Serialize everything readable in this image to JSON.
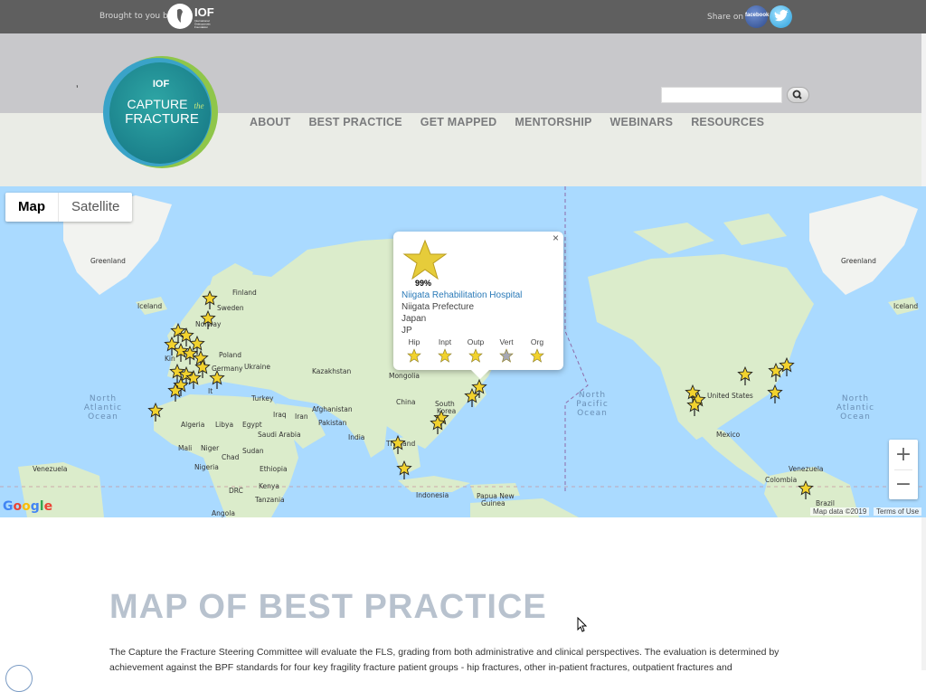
{
  "topbar": {
    "brought_text": "Brought to you by",
    "iof_logo_text": "IOF",
    "iof_logo_sub": "International Osteoporosis Foundation",
    "share_text": "Share on",
    "facebook_label": "facebook"
  },
  "header": {
    "logo_iof": "IOF",
    "logo_capture": "CAPTURE",
    "logo_the": "the",
    "logo_fracture": "FRACTURE",
    "tick_mark": "ʼ",
    "search_placeholder": "",
    "nav": [
      "ABOUT",
      "BEST PRACTICE",
      "GET MAPPED",
      "MENTORSHIP",
      "WEBINARS",
      "RESOURCES"
    ]
  },
  "map": {
    "type_map": "Map",
    "type_satellite": "Satellite",
    "zoom_in": "+",
    "zoom_out": "−",
    "google": "Google",
    "map_data": "Map data ©2019",
    "terms": "Terms of Use",
    "labels": {
      "greenland_left": "Greenland",
      "greenland_right": "Greenland",
      "finland": "Finland",
      "sweden": "Sweden",
      "norway": "Norway",
      "iceland_left": "Iceland",
      "iceland_right": "Iceland",
      "poland": "Poland",
      "germany": "Germany",
      "ukraine": "Ukraine",
      "kazakhstan": "Kazakhstan",
      "mongolia": "Mongolia",
      "china": "China",
      "turkey": "Turkey",
      "iraq": "Iraq",
      "iran": "Iran",
      "afghanistan": "Afghanistan",
      "pakistan": "Pakistan",
      "india": "India",
      "algeria": "Algeria",
      "libya": "Libya",
      "egypt": "Egypt",
      "saudi_arabia": "Saudi Arabia",
      "mali": "Mali",
      "niger": "Niger",
      "chad": "Chad",
      "sudan": "Sudan",
      "nigeria": "Nigeria",
      "ethiopia": "Ethiopia",
      "drc": "DRC",
      "kenya": "Kenya",
      "tanzania": "Tanzania",
      "angola": "Angola",
      "thailand": "Thailand",
      "indonesia": "Indonesia",
      "papua": "Papua New",
      "guinea": "Guinea",
      "south_korea": "South",
      "korea": "Korea",
      "united_states": "United States",
      "mexico": "Mexico",
      "venezuela_left": "Venezuela",
      "venezuela_right": "Venezuela",
      "colombia": "Colombia",
      "brazil": "Brazil",
      "uk": "Kin",
      "italy": "It",
      "na_atlantic_left_1": "North",
      "na_atlantic_left_2": "Atlantic",
      "na_atlantic_left_3": "Ocean",
      "np_1": "North",
      "np_2": "Pacific",
      "np_3": "Ocean",
      "na_atlantic_right_1": "North",
      "na_atlantic_right_2": "Atlantic",
      "na_atlantic_right_3": "Ocean"
    },
    "popup": {
      "close": "×",
      "percent": "99%",
      "name": "Niigata Rehabilitation Hospital",
      "region": "Niigata Prefecture",
      "country": "Japan",
      "code": "JP",
      "categories": [
        {
          "label": "Hip",
          "color": "#f2d22e"
        },
        {
          "label": "Inpt",
          "color": "#f2d22e"
        },
        {
          "label": "Outp",
          "color": "#f2d22e"
        },
        {
          "label": "Vert",
          "color": "#a7a9b4"
        },
        {
          "label": "Org",
          "color": "#f2d22e"
        }
      ]
    }
  },
  "content": {
    "heading": "MAP OF BEST PRACTICE",
    "paragraph": "The Capture the Fracture Steering Committee will evaluate the FLS, grading from both administrative and clinical perspectives. The evaluation is determined by achievement against the BPF standards for four key fragility fracture patient groups - hip fractures, other in-patient fractures, outpatient fractures and"
  },
  "colors": {
    "topbar": "#5f5f5f",
    "header_top": "#c8c8cb",
    "header_bottom": "#eaece6",
    "nav_text": "#7a7b7d",
    "ocean": "#aadaff",
    "land": "#dbeccb",
    "star": "#f2d22e",
    "heading": "#b8c2ce"
  }
}
